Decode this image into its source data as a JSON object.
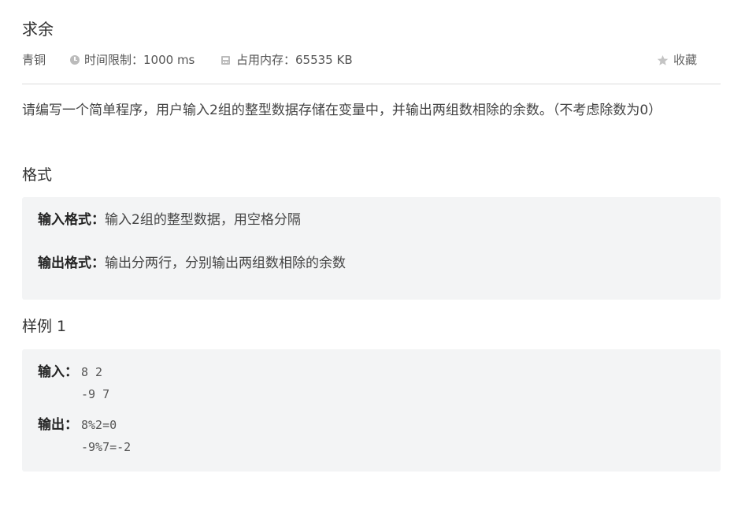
{
  "problem": {
    "title": "求余",
    "level": "青铜",
    "time_limit": "时间限制：1000 ms",
    "memory_limit": "占用内存：65535 KB",
    "favorite_label": "收藏",
    "description": "请编写一个简单程序，用户输入2组的整型数据存储在变量中，并输出两组数相除的余数。（不考虑除数为0）"
  },
  "format": {
    "heading": "格式",
    "input_label": "输入格式：",
    "input_text": "输入2组的整型数据，用空格分隔",
    "output_label": "输出格式：",
    "output_text": "输出分两行，分别输出两组数相除的余数"
  },
  "sample": {
    "heading": "样例 1",
    "input_label": "输入：",
    "input_lines": [
      "8 2",
      "-9 7"
    ],
    "output_label": "输出：",
    "output_lines": [
      "8%2=0",
      "-9%7=-2"
    ]
  },
  "colors": {
    "box_background": "#f3f4f5",
    "divider": "#dcdcdc",
    "icon_gray": "#bbbbbb"
  },
  "icons": {
    "clock": "clock-icon",
    "memory": "memory-icon",
    "favorite": "star-icon"
  }
}
